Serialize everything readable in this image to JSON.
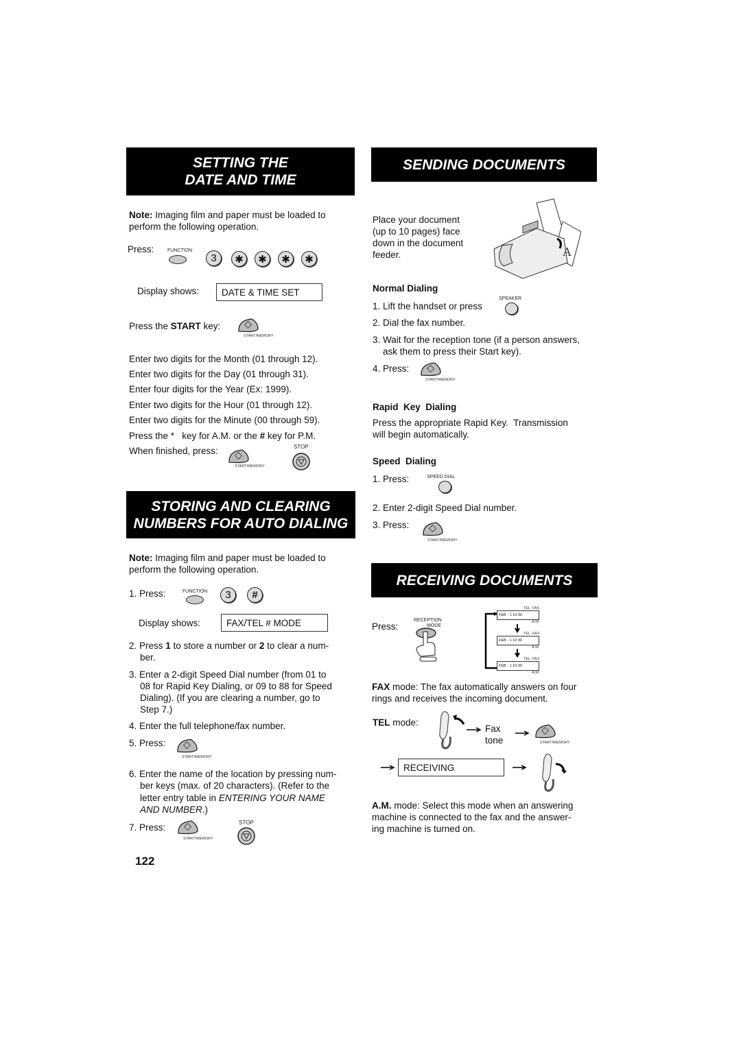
{
  "left": {
    "header1": [
      "SETTING THE",
      "DATE AND TIME"
    ],
    "note_label": "Note:",
    "note_text": " Imaging film and paper must be loaded to",
    "note_text2": "perform the following operation.",
    "press": "Press:",
    "function_label": "FUNCTION",
    "key3": "3",
    "star": "✱",
    "display_shows": "Display shows:",
    "display1": "DATE & TIME SET",
    "press_start_pre": "Press the ",
    "press_start_bold": "START",
    "press_start_post": " key:",
    "start_memory": "START/MEMORY",
    "enter_lines": [
      "Enter two digits for the Month (01 through 12).",
      "Enter two digits for the Day (01 through 31).",
      "Enter four digits for the Year (Ex: 1999).",
      "Enter two digits for the Hour (01 through 12).",
      "Enter two digits for the Minute (00 through 59)."
    ],
    "ampm_pre": "Press the *   key for A.M. or the ",
    "ampm_hash": "#",
    "ampm_post": " key for P.M.",
    "when_finished": "When finished, press:",
    "stop": "STOP",
    "header2": [
      "STORING AND CLEARING",
      "NUMBERS FOR AUTO DIALING"
    ],
    "step1": "1. Press:",
    "hash": "#",
    "display2": "FAX/TEL # MODE",
    "step2_a": "2. Press ",
    "step2_b": "1",
    "step2_c": " to store a number or ",
    "step2_d": "2",
    "step2_e": " to clear a num-",
    "step2_f": "ber.",
    "step3": [
      "3. Enter a 2-digit Speed Dial number (from 01 to",
      "08 for Rapid Key Dialing, or 09 to 88 for Speed",
      "Dialing).  (If you are clearing a number, go to",
      "Step 7.)"
    ],
    "step4": "4. Enter the full telephone/fax number.",
    "step5": "5. Press:",
    "step6": [
      "6. Enter the name of the location by pressing num-",
      "ber keys (max. of 20 characters). (Refer to the",
      "letter entry table in "
    ],
    "step6_italic1": "ENTERING YOUR NAME",
    "step6_italic2": "AND NUMBER",
    "step6_end": ".)",
    "step7": "7. Press:",
    "page_number": "122"
  },
  "right": {
    "header1": "SENDING DOCUMENTS",
    "place_lines": [
      "Place your document",
      "(up to 10 pages) face",
      "down in the document",
      "feeder."
    ],
    "normal_dialing": "Normal  Dialing",
    "nd1": "1. Lift the handset or press",
    "speaker": "SPEAKER",
    "nd2": "2. Dial the fax number.",
    "nd3": [
      "3. Wait for the reception tone (if a person answers,",
      "ask them to press their Start key)."
    ],
    "nd4": "4. Press:",
    "start_memory": "START/MEMORY",
    "rapid": "Rapid  Key  Dialing",
    "rapid_text": [
      "Press the appropriate Rapid Key.  Transmission",
      "will begin automatically."
    ],
    "speed": "Speed  Dialing",
    "sd1": "1. Press:",
    "speed_dial": "SPEED DIAL",
    "sd2": "2. Enter 2-digit Speed Dial number.",
    "sd3": "3. Press:",
    "header2": "RECEIVING DOCUMENTS",
    "press": "Press:",
    "reception": "RECEPTION",
    "mode": "MODE",
    "lcd": {
      "date": "FEB - 1  10:30",
      "tel": "TEL",
      "fax": "FAX",
      "am": "A.M."
    },
    "fax_bold": "FAX",
    "fax_text": " mode: The fax automatically answers on four",
    "fax_text2": "rings and receives the incoming document.",
    "tel_bold": "TEL",
    "tel_text": " mode:",
    "fax_tone": [
      "Fax",
      "tone"
    ],
    "receiving": "RECEIVING",
    "am_bold": "A.M.",
    "am_text": " mode: Select this mode when an answering",
    "am_text2": "machine is connected to the fax and the answer-",
    "am_text3": "ing machine is turned on."
  },
  "colors": {
    "header_bg": "#000000",
    "header_text": "#ffffff",
    "key_fill": "#cccccc"
  }
}
